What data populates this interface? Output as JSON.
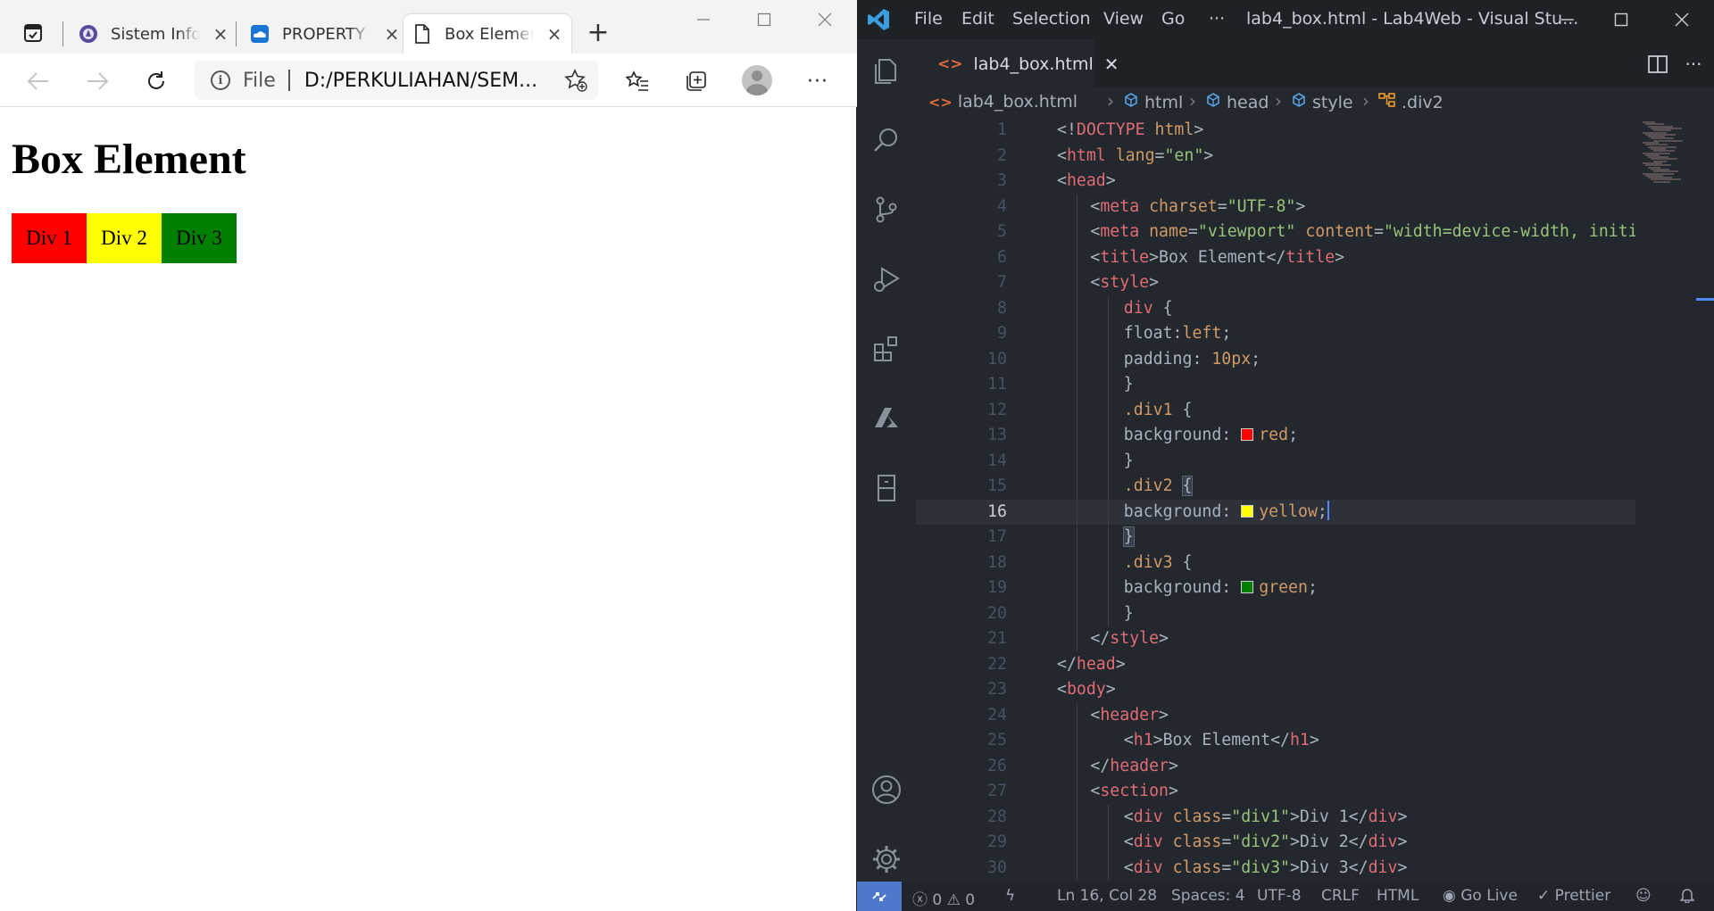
{
  "browser": {
    "tabs": [
      {
        "title": "Sistem Informasi",
        "close": "×"
      },
      {
        "title": "PROPERTY",
        "close": "×"
      },
      {
        "title": "Box Element",
        "close": "×"
      }
    ],
    "new_tab": "+",
    "address": {
      "scheme": "File",
      "url": "D:/PERKULIAHAN/SEM..."
    },
    "page": {
      "heading": "Box Element",
      "boxes": [
        {
          "label": "Div 1",
          "color": "#ff0000"
        },
        {
          "label": "Div 2",
          "color": "#ffff00"
        },
        {
          "label": "Div 3",
          "color": "#008000"
        }
      ]
    }
  },
  "vscode": {
    "menu": [
      "File",
      "Edit",
      "Selection",
      "View",
      "Go",
      "···"
    ],
    "window_title": "lab4_box.html - Lab4Web - Visual Stu...",
    "active_tab": "lab4_box.html",
    "breadcrumbs": [
      "lab4_box.html",
      "html",
      "head",
      "style",
      ".div2"
    ],
    "current_line": 16,
    "code_lines": [
      {
        "n": "1"
      },
      {
        "n": "2"
      },
      {
        "n": "3"
      },
      {
        "n": "4"
      },
      {
        "n": "5"
      },
      {
        "n": "6"
      },
      {
        "n": "7"
      },
      {
        "n": "8"
      },
      {
        "n": "9"
      },
      {
        "n": "10"
      },
      {
        "n": "11"
      },
      {
        "n": "12"
      },
      {
        "n": "13"
      },
      {
        "n": "14"
      },
      {
        "n": "15"
      },
      {
        "n": "16"
      },
      {
        "n": "17"
      },
      {
        "n": "18"
      },
      {
        "n": "19"
      },
      {
        "n": "20"
      },
      {
        "n": "21"
      },
      {
        "n": "22"
      },
      {
        "n": "23"
      },
      {
        "n": "24"
      },
      {
        "n": "25"
      },
      {
        "n": "26"
      },
      {
        "n": "27"
      },
      {
        "n": "28"
      },
      {
        "n": "29"
      },
      {
        "n": "30"
      }
    ],
    "code_text": {
      "l1": [
        "<!",
        "DOCTYPE",
        " ",
        "html",
        ">"
      ],
      "l2": [
        "<",
        "html",
        " ",
        "lang",
        "=",
        "\"en\"",
        ">"
      ],
      "l3": [
        "<",
        "head",
        ">"
      ],
      "l4": [
        "<",
        "meta",
        " ",
        "charset",
        "=",
        "\"UTF-8\"",
        ">"
      ],
      "l5": [
        "<",
        "meta",
        " ",
        "name",
        "=",
        "\"viewport\"",
        " ",
        "content",
        "=",
        "\"width=device-width, initi"
      ],
      "l6": [
        "<",
        "title",
        ">",
        "Box Element",
        "</",
        "title",
        ">"
      ],
      "l7": [
        "<",
        "style",
        ">"
      ],
      "l8": [
        "div",
        " {"
      ],
      "l9": [
        "float",
        ":",
        "left",
        ";"
      ],
      "l10": [
        "padding",
        ": ",
        "10px",
        ";"
      ],
      "l11": [
        "}"
      ],
      "l12": [
        ".div1",
        " {"
      ],
      "l13": [
        "background",
        ": ",
        "red",
        ";"
      ],
      "l14": [
        "}"
      ],
      "l15": [
        ".div2",
        " ",
        "{"
      ],
      "l16": [
        "background",
        ": ",
        "yellow",
        ";"
      ],
      "l17": [
        "}"
      ],
      "l18": [
        ".div3",
        " {"
      ],
      "l19": [
        "background",
        ": ",
        "green",
        ";"
      ],
      "l20": [
        "}"
      ],
      "l21": [
        "</",
        "style",
        ">"
      ],
      "l22": [
        "</",
        "head",
        ">"
      ],
      "l23": [
        "<",
        "body",
        ">"
      ],
      "l24": [
        "<",
        "header",
        ">"
      ],
      "l25": [
        "<",
        "h1",
        ">",
        "Box Element",
        "</",
        "h1",
        ">"
      ],
      "l26": [
        "</",
        "header",
        ">"
      ],
      "l27": [
        "<",
        "section",
        ">"
      ],
      "l28": [
        "<",
        "div",
        " ",
        "class",
        "=",
        "\"div1\"",
        ">",
        "Div 1",
        "</",
        "div",
        ">"
      ],
      "l29": [
        "<",
        "div",
        " ",
        "class",
        "=",
        "\"div2\"",
        ">",
        "Div 2",
        "</",
        "div",
        ">"
      ],
      "l30": [
        "<",
        "div",
        " ",
        "class",
        "=",
        "\"div3\"",
        ">",
        "Div 3",
        "</",
        "div",
        ">"
      ]
    },
    "swatch_colors": {
      "red": "#ff0000",
      "yellow": "#ffff00",
      "green": "#008000"
    },
    "status": {
      "errors": "0",
      "warnings": "0",
      "position": "Ln 16, Col 28",
      "spaces": "Spaces: 4",
      "encoding": "UTF-8",
      "eol": "CRLF",
      "language": "HTML",
      "golive": "Go Live",
      "prettier": "Prettier"
    },
    "colors": {
      "accent": "#4d78cc",
      "tag": "#e06c75",
      "attr": "#d19a66",
      "string": "#98c379"
    }
  }
}
